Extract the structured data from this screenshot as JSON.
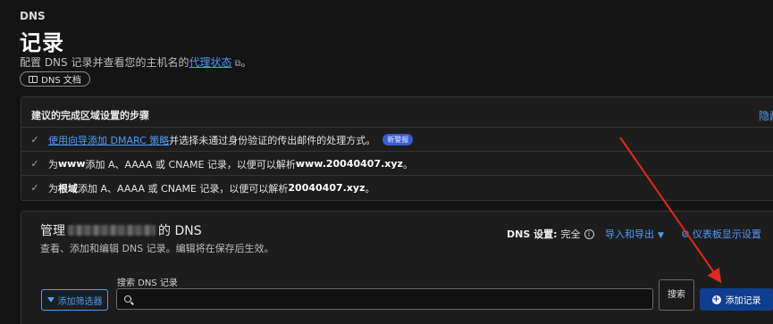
{
  "header": {
    "section": "DNS",
    "title": "记录",
    "subtitle_prefix": "配置 DNS 记录并查看您的主机名的",
    "subtitle_link": "代理状态",
    "subtitle_suffix": "。",
    "external_icon": "external-link-icon",
    "doc_button": "DNS 文档",
    "doc_icon": "book-icon"
  },
  "steps": {
    "title": "建议的完成区域设置的步骤",
    "hide": "隐藏",
    "check_icon": "check-icon",
    "items": [
      {
        "link": "使用向导添加 DMARC 策略",
        "text": "并选择未通过身份验证的传出邮件的处理方式。",
        "badge": "新警报"
      },
      {
        "pre": "为 ",
        "bold": "www",
        "mid": " 添加 A、AAAA 或 CNAME 记录，以便可以解析 ",
        "bold2": "www.20040407.xyz",
        "post": "。"
      },
      {
        "pre": "为",
        "bold": "根域",
        "mid": "添加 A、AAAA 或 CNAME 记录，以便可以解析 ",
        "bold2": "20040407.xyz",
        "post": "。"
      }
    ]
  },
  "dns": {
    "title_prefix": "管理",
    "title_suffix": "的 DNS",
    "description": "查看、添加和编辑 DNS 记录。编辑将在保存后生效。",
    "settings_label": "DNS 设置:",
    "settings_value": "完全",
    "import_export": "导入和导出",
    "dashboard_display": "仪表板显示设置",
    "filter_button": "添加筛选器",
    "search_label": "搜索 DNS 记录",
    "search_value": "",
    "search_button": "搜索",
    "add_record_button": "添加记录"
  },
  "colors": {
    "background": "#141414",
    "card": "#1d1d1d",
    "link": "#4e9cf4",
    "primary_button": "#0f3e8f",
    "annotation_arrow": "#e0281e"
  }
}
